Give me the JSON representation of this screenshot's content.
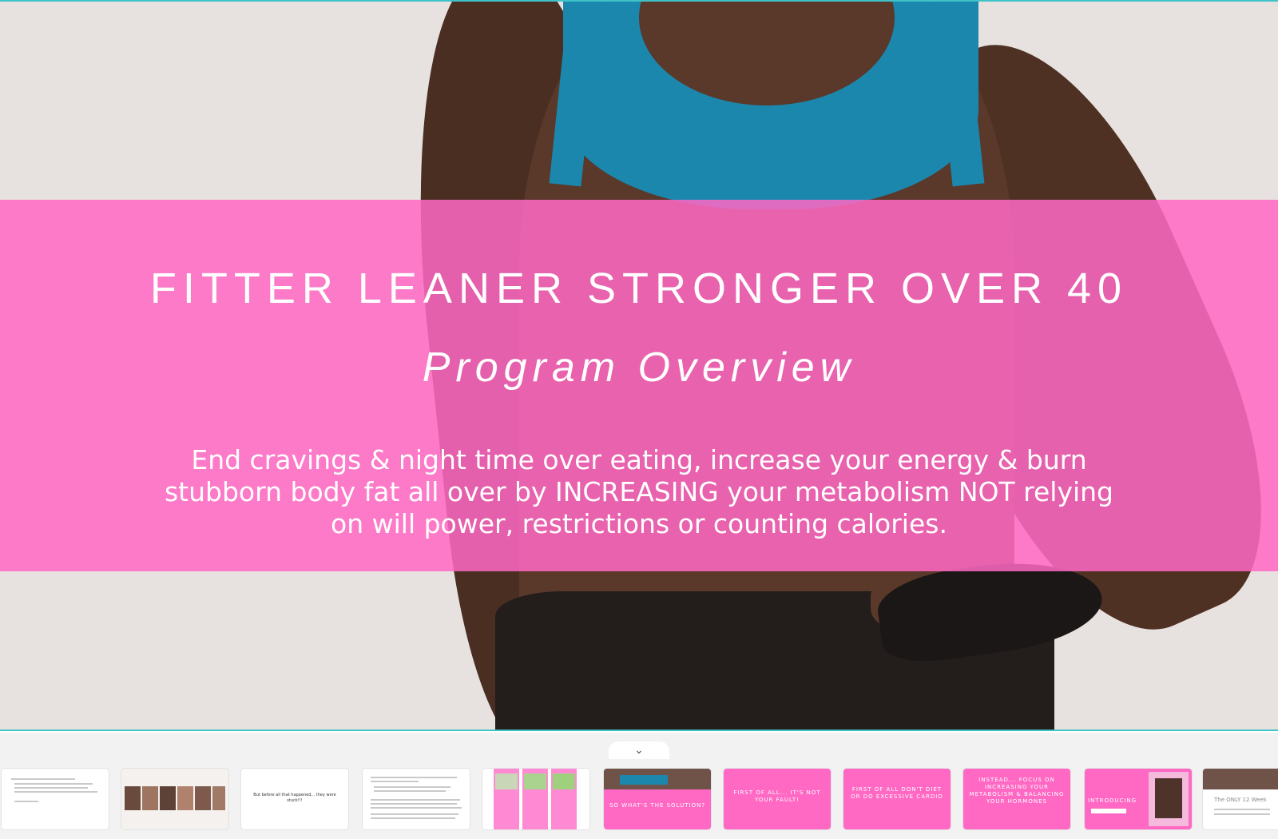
{
  "slide": {
    "title": "FITTER LEANER STRONGER OVER 40",
    "subtitle": "Program Overview",
    "description": "End cravings & night time over eating, increase your energy & burn stubborn body fat all over by INCREASING your metabolism NOT relying on will power, restrictions or counting calories."
  },
  "filmstrip": {
    "collapse_icon": "chevron-down-icon",
    "thumbnails": [
      {
        "text": ""
      },
      {
        "text": ""
      },
      {
        "text": "But before all that happened... they were stuck!!!"
      },
      {
        "text": ""
      },
      {
        "text": ""
      },
      {
        "text": "SO WHAT'S THE SOLUTION?"
      },
      {
        "text": "FIRST OF ALL... IT'S NOT YOUR FAULT!"
      },
      {
        "text": "FIRST OF ALL DON'T DIET OR DO EXCESSIVE CARDIO"
      },
      {
        "text": "INSTEAD... FOCUS ON INCREASING YOUR METABOLISM & BALANCING YOUR HORMONES"
      },
      {
        "text": "INTRODUCING"
      },
      {
        "text": "The ONLY 12 Week"
      }
    ]
  },
  "colors": {
    "accent_pink": "#ff69c4",
    "frame_teal": "#3fc3c9",
    "top_blue": "#1b87ad"
  }
}
